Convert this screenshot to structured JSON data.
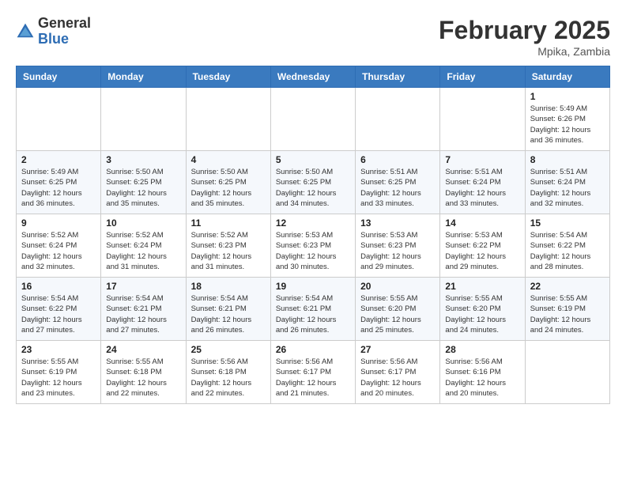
{
  "header": {
    "logo_line1": "General",
    "logo_line2": "Blue",
    "title": "February 2025",
    "location": "Mpika, Zambia"
  },
  "weekdays": [
    "Sunday",
    "Monday",
    "Tuesday",
    "Wednesday",
    "Thursday",
    "Friday",
    "Saturday"
  ],
  "weeks": [
    [
      {
        "day": "",
        "info": ""
      },
      {
        "day": "",
        "info": ""
      },
      {
        "day": "",
        "info": ""
      },
      {
        "day": "",
        "info": ""
      },
      {
        "day": "",
        "info": ""
      },
      {
        "day": "",
        "info": ""
      },
      {
        "day": "1",
        "info": "Sunrise: 5:49 AM\nSunset: 6:26 PM\nDaylight: 12 hours\nand 36 minutes."
      }
    ],
    [
      {
        "day": "2",
        "info": "Sunrise: 5:49 AM\nSunset: 6:25 PM\nDaylight: 12 hours\nand 36 minutes."
      },
      {
        "day": "3",
        "info": "Sunrise: 5:50 AM\nSunset: 6:25 PM\nDaylight: 12 hours\nand 35 minutes."
      },
      {
        "day": "4",
        "info": "Sunrise: 5:50 AM\nSunset: 6:25 PM\nDaylight: 12 hours\nand 35 minutes."
      },
      {
        "day": "5",
        "info": "Sunrise: 5:50 AM\nSunset: 6:25 PM\nDaylight: 12 hours\nand 34 minutes."
      },
      {
        "day": "6",
        "info": "Sunrise: 5:51 AM\nSunset: 6:25 PM\nDaylight: 12 hours\nand 33 minutes."
      },
      {
        "day": "7",
        "info": "Sunrise: 5:51 AM\nSunset: 6:24 PM\nDaylight: 12 hours\nand 33 minutes."
      },
      {
        "day": "8",
        "info": "Sunrise: 5:51 AM\nSunset: 6:24 PM\nDaylight: 12 hours\nand 32 minutes."
      }
    ],
    [
      {
        "day": "9",
        "info": "Sunrise: 5:52 AM\nSunset: 6:24 PM\nDaylight: 12 hours\nand 32 minutes."
      },
      {
        "day": "10",
        "info": "Sunrise: 5:52 AM\nSunset: 6:24 PM\nDaylight: 12 hours\nand 31 minutes."
      },
      {
        "day": "11",
        "info": "Sunrise: 5:52 AM\nSunset: 6:23 PM\nDaylight: 12 hours\nand 31 minutes."
      },
      {
        "day": "12",
        "info": "Sunrise: 5:53 AM\nSunset: 6:23 PM\nDaylight: 12 hours\nand 30 minutes."
      },
      {
        "day": "13",
        "info": "Sunrise: 5:53 AM\nSunset: 6:23 PM\nDaylight: 12 hours\nand 29 minutes."
      },
      {
        "day": "14",
        "info": "Sunrise: 5:53 AM\nSunset: 6:22 PM\nDaylight: 12 hours\nand 29 minutes."
      },
      {
        "day": "15",
        "info": "Sunrise: 5:54 AM\nSunset: 6:22 PM\nDaylight: 12 hours\nand 28 minutes."
      }
    ],
    [
      {
        "day": "16",
        "info": "Sunrise: 5:54 AM\nSunset: 6:22 PM\nDaylight: 12 hours\nand 27 minutes."
      },
      {
        "day": "17",
        "info": "Sunrise: 5:54 AM\nSunset: 6:21 PM\nDaylight: 12 hours\nand 27 minutes."
      },
      {
        "day": "18",
        "info": "Sunrise: 5:54 AM\nSunset: 6:21 PM\nDaylight: 12 hours\nand 26 minutes."
      },
      {
        "day": "19",
        "info": "Sunrise: 5:54 AM\nSunset: 6:21 PM\nDaylight: 12 hours\nand 26 minutes."
      },
      {
        "day": "20",
        "info": "Sunrise: 5:55 AM\nSunset: 6:20 PM\nDaylight: 12 hours\nand 25 minutes."
      },
      {
        "day": "21",
        "info": "Sunrise: 5:55 AM\nSunset: 6:20 PM\nDaylight: 12 hours\nand 24 minutes."
      },
      {
        "day": "22",
        "info": "Sunrise: 5:55 AM\nSunset: 6:19 PM\nDaylight: 12 hours\nand 24 minutes."
      }
    ],
    [
      {
        "day": "23",
        "info": "Sunrise: 5:55 AM\nSunset: 6:19 PM\nDaylight: 12 hours\nand 23 minutes."
      },
      {
        "day": "24",
        "info": "Sunrise: 5:55 AM\nSunset: 6:18 PM\nDaylight: 12 hours\nand 22 minutes."
      },
      {
        "day": "25",
        "info": "Sunrise: 5:56 AM\nSunset: 6:18 PM\nDaylight: 12 hours\nand 22 minutes."
      },
      {
        "day": "26",
        "info": "Sunrise: 5:56 AM\nSunset: 6:17 PM\nDaylight: 12 hours\nand 21 minutes."
      },
      {
        "day": "27",
        "info": "Sunrise: 5:56 AM\nSunset: 6:17 PM\nDaylight: 12 hours\nand 20 minutes."
      },
      {
        "day": "28",
        "info": "Sunrise: 5:56 AM\nSunset: 6:16 PM\nDaylight: 12 hours\nand 20 minutes."
      },
      {
        "day": "",
        "info": ""
      }
    ]
  ]
}
